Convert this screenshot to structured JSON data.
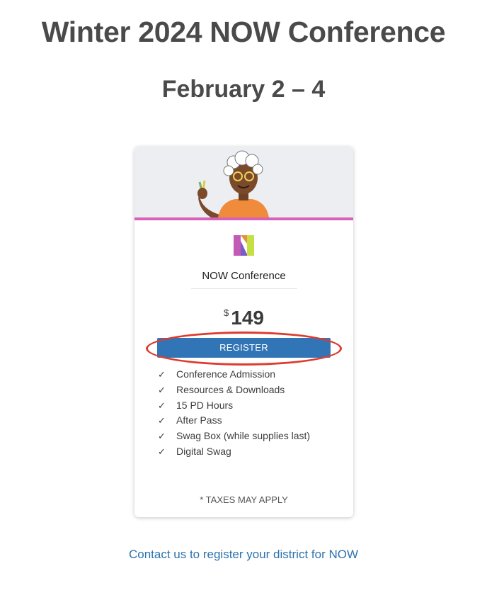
{
  "header": {
    "title": "Winter 2024 NOW Conference",
    "dates": "February 2 – 4"
  },
  "card": {
    "illustration": "person-waving-illustration",
    "logo_icon": "now-logo-icon",
    "product_name": "NOW Conference",
    "price_currency": "$",
    "price_amount": "149",
    "register_label": "REGISTER",
    "features": [
      "Conference Admission",
      "Resources & Downloads",
      "15 PD Hours",
      "After Pass",
      "Swag Box (while supplies last)",
      "Digital Swag"
    ],
    "check_icon": "✓",
    "tax_note": "* TAXES MAY APPLY"
  },
  "annotation": {
    "highlight_color": "#dd3b2e"
  },
  "footer": {
    "contact_link": "Contact us to register your district for NOW"
  },
  "colors": {
    "heading": "#4a4a4a",
    "button": "#3275b7",
    "accent_line": "#d761b8",
    "link": "#2b72ad"
  }
}
